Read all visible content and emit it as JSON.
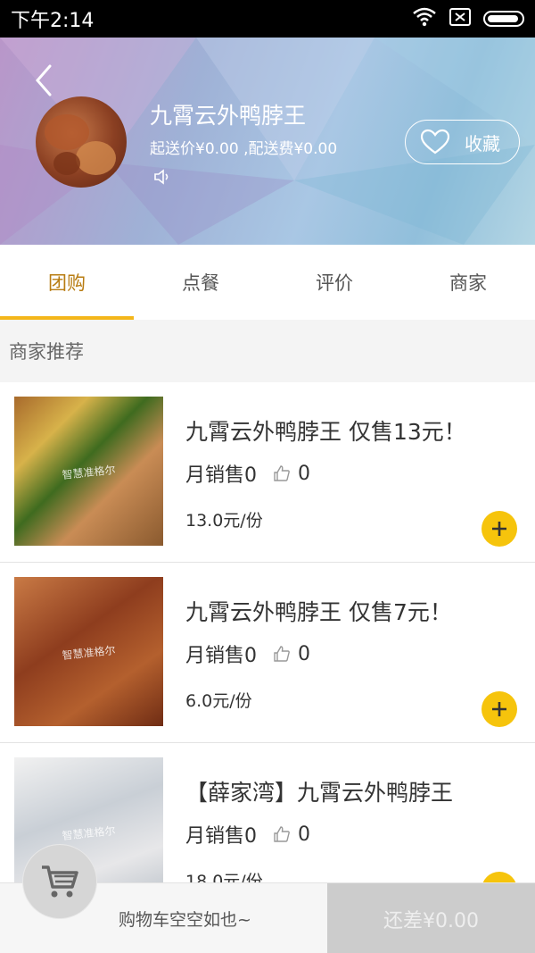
{
  "status_bar": {
    "time": "下午2:14",
    "icons": [
      "wifi-icon",
      "sim-icon",
      "battery-icon"
    ]
  },
  "header": {
    "back_icon": "chevron-left-icon",
    "shop_name": "九霄云外鸭脖王",
    "delivery_info": "起送价¥0.00 ,配送费¥0.00",
    "speaker_icon": "speaker-icon",
    "favorite_label": "收藏",
    "favorite_icon": "heart-icon"
  },
  "tabs": [
    {
      "label": "团购",
      "active": true
    },
    {
      "label": "点餐",
      "active": false
    },
    {
      "label": "评价",
      "active": false
    },
    {
      "label": "商家",
      "active": false
    }
  ],
  "section_title": "商家推荐",
  "products": [
    {
      "title": "九霄云外鸭脖王 仅售13元！",
      "monthly_sales_label": "月销售0",
      "likes": "0",
      "price": "13.0元/份"
    },
    {
      "title": "九霄云外鸭脖王 仅售7元！",
      "monthly_sales_label": "月销售0",
      "likes": "0",
      "price": "6.0元/份"
    },
    {
      "title": "【薛家湾】九霄云外鸭脖王",
      "monthly_sales_label": "月销售0",
      "likes": "0",
      "price": "18.0元/份"
    }
  ],
  "cart": {
    "empty_text": "购物车空空如也~",
    "checkout_label": "还差¥0.00",
    "cart_icon": "shopping-cart-icon"
  },
  "colors": {
    "accent": "#f4b61a",
    "active_tab_text": "#b87c12",
    "add_button": "#f6c40c",
    "checkout_disabled": "#cccccc"
  }
}
